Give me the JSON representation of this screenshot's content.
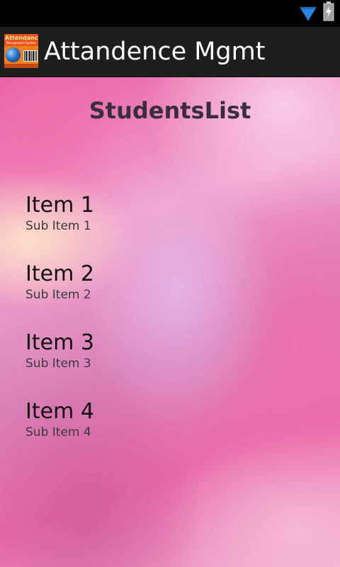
{
  "status_bar": {
    "icons": [
      "wifi-icon",
      "battery-charging-icon"
    ]
  },
  "action_bar": {
    "app_icon": {
      "name": "attendance-app-icon",
      "line1": "Attendance",
      "line2": "Management System"
    },
    "title": "Attandence Mgmt"
  },
  "main": {
    "title": "StudentsList",
    "items": [
      {
        "label": "Item 1",
        "sub_label": "Sub Item 1"
      },
      {
        "label": "Item 2",
        "sub_label": "Sub Item 2"
      },
      {
        "label": "Item 3",
        "sub_label": "Sub Item 3"
      },
      {
        "label": "Item 4",
        "sub_label": "Sub Item 4"
      }
    ]
  },
  "colors": {
    "status_bar": "#000000",
    "action_bar": "#1e1e1e",
    "title_text": "#3a2e3e",
    "wifi": "#1f6fbf",
    "background_accent": "#e85ea0"
  }
}
